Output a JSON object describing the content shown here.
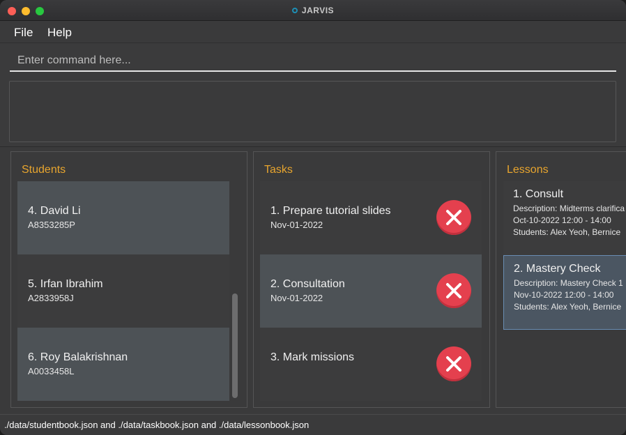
{
  "window": {
    "title": "JARVIS"
  },
  "menu": {
    "file": "File",
    "help": "Help"
  },
  "command": {
    "placeholder": "Enter command here...",
    "value": ""
  },
  "result": {
    "text": ""
  },
  "students": {
    "title": "Students",
    "items": [
      {
        "name": "4.  David Li",
        "id": "A8353285P"
      },
      {
        "name": "5.  Irfan Ibrahim",
        "id": "A2833958J"
      },
      {
        "name": "6.  Roy Balakrishnan",
        "id": "A0033458L"
      }
    ]
  },
  "tasks": {
    "title": "Tasks",
    "items": [
      {
        "name": "1.  Prepare tutorial slides",
        "date": "Nov-01-2022"
      },
      {
        "name": "2.  Consultation",
        "date": "Nov-01-2022"
      },
      {
        "name": "3.  Mark missions",
        "date": ""
      }
    ]
  },
  "lessons": {
    "title": "Lessons",
    "items": [
      {
        "name": "1.  Consult",
        "description": "Description: Midterms clarifica",
        "time": "Oct-10-2022 12:00 - 14:00",
        "students": "Students: Alex Yeoh, Bernice"
      },
      {
        "name": "2.  Mastery Check",
        "description": "Description: Mastery Check 1",
        "time": "Nov-10-2022 12:00 - 14:00",
        "students": "Students: Alex Yeoh, Bernice"
      }
    ]
  },
  "status": {
    "text": "./data/studentbook.json and ./data/taskbook.json and ./data/lessonbook.json"
  },
  "colors": {
    "accent": "#e8a52e",
    "delete": "#e4404e",
    "selected_border": "#6a8db3"
  }
}
